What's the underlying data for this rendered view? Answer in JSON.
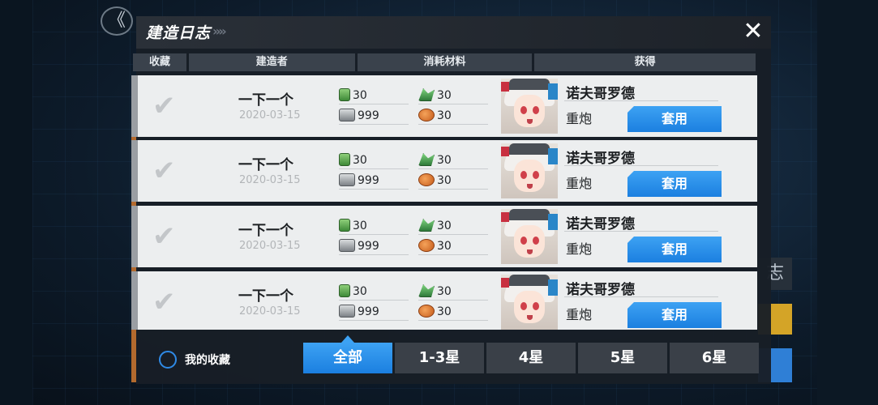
{
  "dialog": {
    "title": "建造日志",
    "title_chevrons": "»»",
    "close_glyph": "✕"
  },
  "back_glyph": "《",
  "background": {
    "right_button_glyph": "志"
  },
  "table_header": {
    "favorite": "收藏",
    "builder": "建造者",
    "materials": "消耗材料",
    "obtained": "获得"
  },
  "rows": [
    {
      "builder": "一下一个",
      "date": "2020-03-15",
      "oil": "30",
      "ammo": "30",
      "steel": "999",
      "bauxite": "30",
      "ship_name": "诺夫哥罗德",
      "ship_type": "重炮",
      "apply_label": "套用"
    },
    {
      "builder": "一下一个",
      "date": "2020-03-15",
      "oil": "30",
      "ammo": "30",
      "steel": "999",
      "bauxite": "30",
      "ship_name": "诺夫哥罗德",
      "ship_type": "重炮",
      "apply_label": "套用"
    },
    {
      "builder": "一下一个",
      "date": "2020-03-15",
      "oil": "30",
      "ammo": "30",
      "steel": "999",
      "bauxite": "30",
      "ship_name": "诺夫哥罗德",
      "ship_type": "重炮",
      "apply_label": "套用"
    },
    {
      "builder": "一下一个",
      "date": "2020-03-15",
      "oil": "30",
      "ammo": "30",
      "steel": "999",
      "bauxite": "30",
      "ship_name": "诺夫哥罗德",
      "ship_type": "重炮",
      "apply_label": "套用"
    }
  ],
  "check_glyph": "✔",
  "favorites_toggle": {
    "label": "我的收藏",
    "checked": false
  },
  "filters": [
    {
      "label": "全部",
      "active": true
    },
    {
      "label": "1-3星",
      "active": false
    },
    {
      "label": "4星",
      "active": false
    },
    {
      "label": "5星",
      "active": false
    },
    {
      "label": "6星",
      "active": false
    }
  ],
  "colors": {
    "accent_blue": "#1b7fe0",
    "dialog_bg": "#181e26",
    "row_bg": "#eceeef"
  }
}
